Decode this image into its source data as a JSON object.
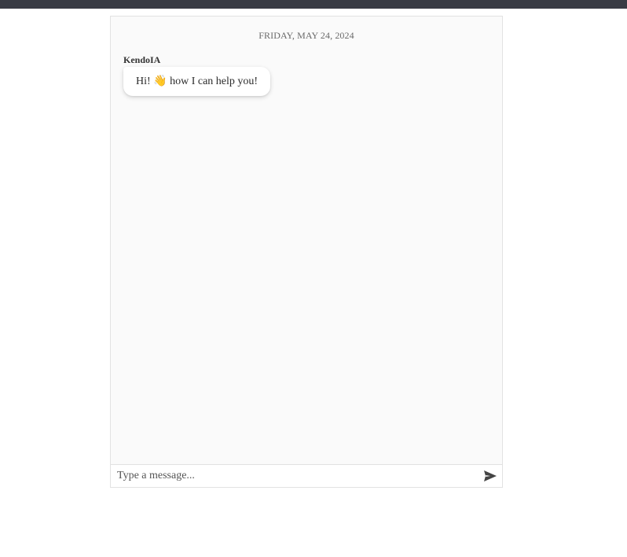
{
  "chat": {
    "date_divider": "FRIDAY, MAY 24, 2024",
    "messages": [
      {
        "author": "KendoIA",
        "text": "Hi! 👋 how I can help you!"
      }
    ],
    "composer": {
      "placeholder": "Type a message...",
      "send_icon": "send-icon"
    }
  },
  "colors": {
    "top_bar": "#393b44",
    "chat_background": "#fafafa",
    "border": "#e2e2e2"
  }
}
